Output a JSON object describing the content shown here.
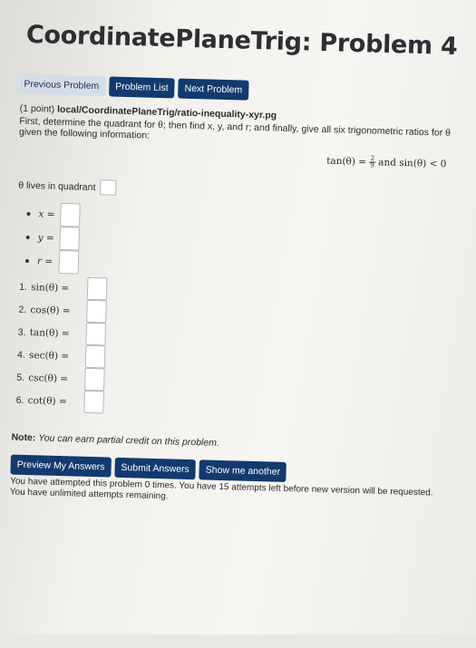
{
  "page_title": "CoordinatePlaneTrig: Problem 4",
  "nav": {
    "previous_label": "Previous Problem",
    "list_label": "Problem List",
    "next_label": "Next Problem"
  },
  "problem": {
    "points": "(1 point)",
    "source": "local/CoordinatePlaneTrig/ratio-inequality-xyr.pg",
    "instructions": "First, determine the quadrant for θ; then find x, y, and r; and finally, give all six trigonometric ratios for θ given the following information:",
    "given": {
      "tan_prefix": "tan(θ) = ",
      "frac_num": "2",
      "frac_den": "9",
      "tail": "and sin(θ) < 0"
    },
    "quadrant_label": "θ lives in quadrant",
    "quadrant_value": "",
    "xyr": [
      {
        "label": "x =",
        "value": ""
      },
      {
        "label": "y =",
        "value": ""
      },
      {
        "label": "r =",
        "value": ""
      }
    ],
    "ratios": [
      {
        "num": "1.",
        "label": "sin(θ) =",
        "value": ""
      },
      {
        "num": "2.",
        "label": "cos(θ) =",
        "value": ""
      },
      {
        "num": "3.",
        "label": "tan(θ) =",
        "value": ""
      },
      {
        "num": "4.",
        "label": "sec(θ) =",
        "value": ""
      },
      {
        "num": "5.",
        "label": "csc(θ) =",
        "value": ""
      },
      {
        "num": "6.",
        "label": "cot(θ) =",
        "value": ""
      }
    ]
  },
  "note": {
    "bold": "Note:",
    "text": "You can earn partial credit on this problem."
  },
  "actions": {
    "preview_label": "Preview My Answers",
    "submit_label": "Submit Answers",
    "show_label": "Show me another"
  },
  "status": {
    "attempts": "You have attempted this problem 0 times. You have 15 attempts left before new version will be requested.",
    "unlimited": "You have unlimited attempts remaining."
  },
  "colors": {
    "button_primary": "#123a6e",
    "button_light": "#d5dde8"
  }
}
